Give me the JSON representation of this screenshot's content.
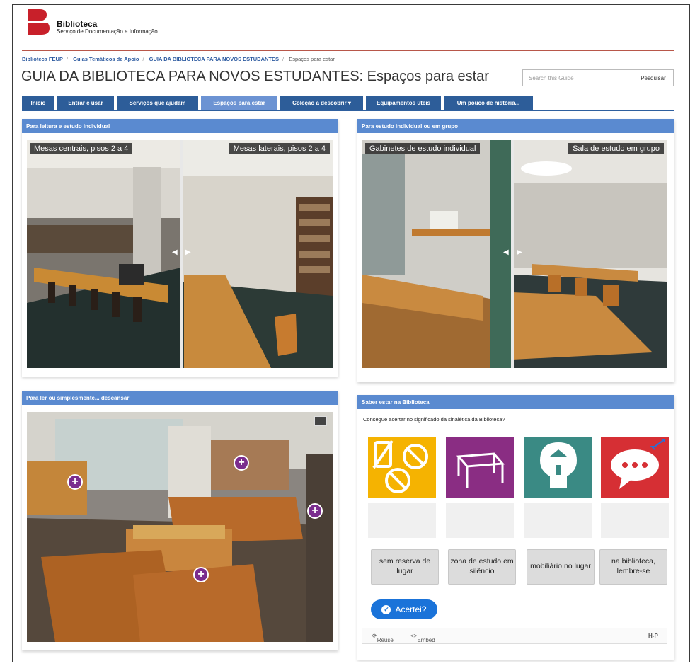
{
  "header": {
    "logo_name": "Biblioteca",
    "logo_subtitle": "Serviço de Documentação e Informação"
  },
  "breadcrumb": [
    "Biblioteca FEUP",
    "Guias Temáticos de Apoio",
    "GUIA DA BIBLIOTECA PARA NOVOS ESTUDANTES",
    "Espaços para estar"
  ],
  "page": {
    "title": "GUIA DA BIBLIOTECA PARA NOVOS ESTUDANTES: Espaços para estar"
  },
  "search": {
    "placeholder": "Search this Guide",
    "button_label": "Pesquisar"
  },
  "tabs": [
    {
      "label": "Início"
    },
    {
      "label": "Entrar e usar"
    },
    {
      "label": "Serviços que ajudam"
    },
    {
      "label": "Espaços para estar",
      "active": true
    },
    {
      "label": "Coleção a descobrir ▾"
    },
    {
      "label": "Equipamentos úteis"
    },
    {
      "label": "Um pouco de história..."
    }
  ],
  "panels": {
    "individual": {
      "heading": "Para leitura e estudo individual",
      "left_caption": "Mesas centrais, pisos 2 a 4",
      "right_caption": "Mesas laterais, pisos 2 a 4"
    },
    "group": {
      "heading": "Para estudo individual ou em grupo",
      "left_caption": "Gabinetes de estudo individual",
      "right_caption": "Sala de estudo em grupo"
    },
    "relax": {
      "heading": "Para ler ou simplesmente... descansar"
    },
    "quiz": {
      "heading": "Saber estar na Biblioteca",
      "question": "Consegue acertar no significado da sinalética da Biblioteca?",
      "cards": [
        {
          "icon": "no-phone-no-food-no-smoking-icon",
          "color": "#f5b301"
        },
        {
          "icon": "table-icon",
          "color": "#8a2d83"
        },
        {
          "icon": "lamp-bulb-icon",
          "color": "#3a8a84"
        },
        {
          "icon": "speech-bubble-icon",
          "color": "#d62f34"
        }
      ],
      "labels": [
        "sem reserva de lugar",
        "zona de estudo em silêncio",
        "mobiliário no lugar",
        "na biblioteca, lembre-se"
      ],
      "check_label": "Acertei?",
      "reuse_label": "Reuse",
      "embed_label": "Embed",
      "h5p_label": "H-P"
    }
  },
  "colors": {
    "nav": "#2d5d99",
    "nav_active": "#6c93d3",
    "panel_header": "#5a8ad0",
    "accent_rule": "#b8574a",
    "hotspot": "#7b2d8e",
    "check_button": "#1a73d9"
  }
}
